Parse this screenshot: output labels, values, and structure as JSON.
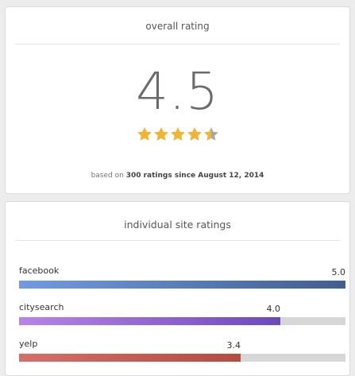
{
  "overall": {
    "title": "overall rating",
    "score": "4.5",
    "stars": 4.5,
    "based_on_prefix": "based on ",
    "ratings_count_text": "300 ratings since August 12, 2014",
    "colors": {
      "star_filled": "#f3b42e",
      "star_empty": "#a7a7a7"
    }
  },
  "sites": {
    "title": "individual site ratings",
    "max": 5,
    "items": [
      {
        "name": "facebook",
        "value": "5.0",
        "rating": 5.0,
        "color_from": "#6f9be6",
        "color_to": "#3f5f93"
      },
      {
        "name": "citysearch",
        "value": "4.0",
        "rating": 4.0,
        "color_from": "#b883eb",
        "color_to": "#6c48c0"
      },
      {
        "name": "yelp",
        "value": "3.4",
        "rating": 3.4,
        "color_from": "#d86e66",
        "color_to": "#b84a3e"
      }
    ]
  }
}
